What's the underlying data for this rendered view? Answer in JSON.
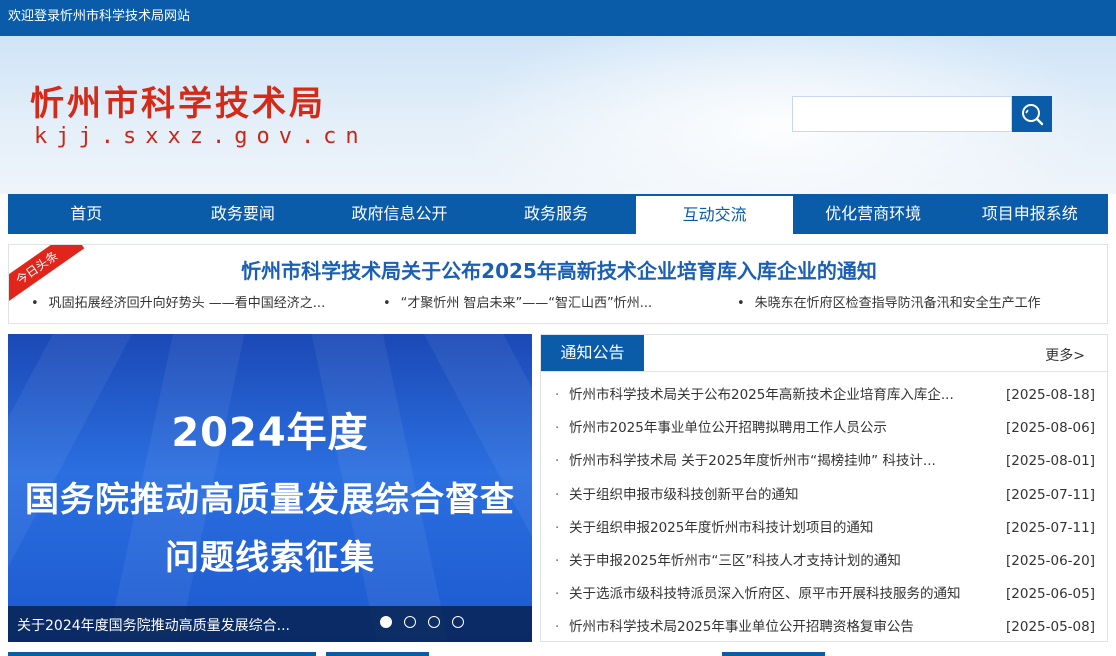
{
  "topbar": {
    "welcome": "欢迎登录忻州市科学技术局网站"
  },
  "header": {
    "title": "忻州市科学技术局",
    "domain": "kjj.sxxz.gov.cn",
    "search_placeholder": ""
  },
  "nav": {
    "items": [
      {
        "label": "首页"
      },
      {
        "label": "政务要闻"
      },
      {
        "label": "政府信息公开"
      },
      {
        "label": "政务服务"
      },
      {
        "label": "互动交流"
      },
      {
        "label": "优化营商环境"
      },
      {
        "label": "项目申报系统"
      }
    ],
    "active_index": 4
  },
  "headline": {
    "ribbon": "今日头条",
    "title": "忻州市科学技术局关于公布2025年高新技术企业培育库入库企业的通知",
    "sub": [
      "巩固拓展经济回升向好势头 ——看中国经济之...",
      "“才聚忻州 智启未来”——“智汇山西”忻州...",
      "朱晓东在忻府区检查指导防汛备汛和安全生产工作"
    ]
  },
  "slider": {
    "year_line": "2024年度",
    "line1": "国务院推动高质量发展综合督查",
    "line2": "问题线索征集",
    "caption": "关于2024年度国务院推动高质量发展综合...",
    "dot_count": 4,
    "active_dot": 0
  },
  "notice": {
    "tab": "通知公告",
    "more": "更多>",
    "items": [
      {
        "title": "忻州市科学技术局关于公布2025年高新技术企业培育库入库企...",
        "date": "[2025-08-18]"
      },
      {
        "title": "忻州市2025年事业单位公开招聘拟聘用工作人员公示",
        "date": "[2025-08-06]"
      },
      {
        "title": "忻州市科学技术局 关于2025年度忻州市“揭榜挂帅” 科技计...",
        "date": "[2025-08-01]"
      },
      {
        "title": "关于组织申报市级科技创新平台的通知",
        "date": "[2025-07-11]"
      },
      {
        "title": "关于组织申报2025年度忻州市科技计划项目的通知",
        "date": "[2025-07-11]"
      },
      {
        "title": "关于申报2025年忻州市“三区”科技人才支持计划的通知",
        "date": "[2025-06-20]"
      },
      {
        "title": "关于选派市级科技特派员深入忻府区、原平市开展科技服务的通知",
        "date": "[2025-06-05]"
      },
      {
        "title": "忻州市科学技术局2025年事业单位公开招聘资格复审公告",
        "date": "[2025-05-08]"
      }
    ]
  },
  "colors": {
    "primary": "#0a5ba8",
    "accent_red": "#d42a17",
    "headline_blue": "#1a5fb4"
  }
}
